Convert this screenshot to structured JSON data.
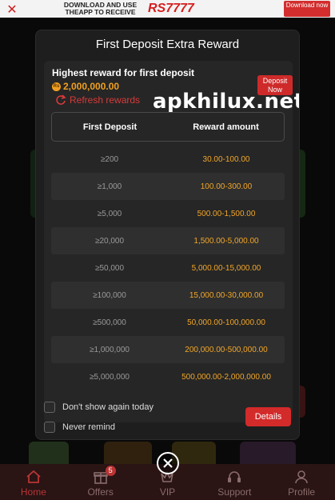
{
  "promo": {
    "close_icon": "close-icon",
    "text": "DOWNLOAD AND USE THEAPP TO RECEIVE",
    "amount": "RS7777",
    "download_label": "Download now"
  },
  "modal": {
    "title": "First Deposit Extra Reward",
    "highest_label": "Highest reward for first deposit",
    "currency_symbol": "Rs",
    "highest_value": "2,000,000.00",
    "refresh_label": "Refresh rewards",
    "deposit_button": "Deposit Now",
    "watermark": "apkhilux.net",
    "table": {
      "headers": [
        "First Deposit",
        "Reward amount"
      ],
      "rows": [
        {
          "deposit": "≥200",
          "reward": "30.00-100.00"
        },
        {
          "deposit": "≥1,000",
          "reward": "100.00-300.00"
        },
        {
          "deposit": "≥5,000",
          "reward": "500.00-1,500.00"
        },
        {
          "deposit": "≥20,000",
          "reward": "1,500.00-5,000.00"
        },
        {
          "deposit": "≥50,000",
          "reward": "5,000.00-15,000.00"
        },
        {
          "deposit": "≥100,000",
          "reward": "15,000.00-30,000.00"
        },
        {
          "deposit": "≥500,000",
          "reward": "50,000.00-100,000.00"
        },
        {
          "deposit": "≥1,000,000",
          "reward": "200,000.00-500,000.00"
        },
        {
          "deposit": "≥5,000,000",
          "reward": "500,000.00-2,000,000.00"
        }
      ]
    },
    "dont_show_today": "Don't show again today",
    "never_remind": "Never remind",
    "details_button": "Details"
  },
  "bottom_nav": {
    "items": [
      {
        "label": "Home",
        "icon": "home-icon"
      },
      {
        "label": "Offers",
        "icon": "gift-icon",
        "badge": "5"
      },
      {
        "label": "VIP",
        "icon": "vip-icon"
      },
      {
        "label": "Support",
        "icon": "headset-icon"
      },
      {
        "label": "Profile",
        "icon": "person-icon"
      }
    ]
  },
  "colors": {
    "accent": "#d32a2a",
    "reward": "#f2a628",
    "modal_bg": "#1e1e1e"
  }
}
